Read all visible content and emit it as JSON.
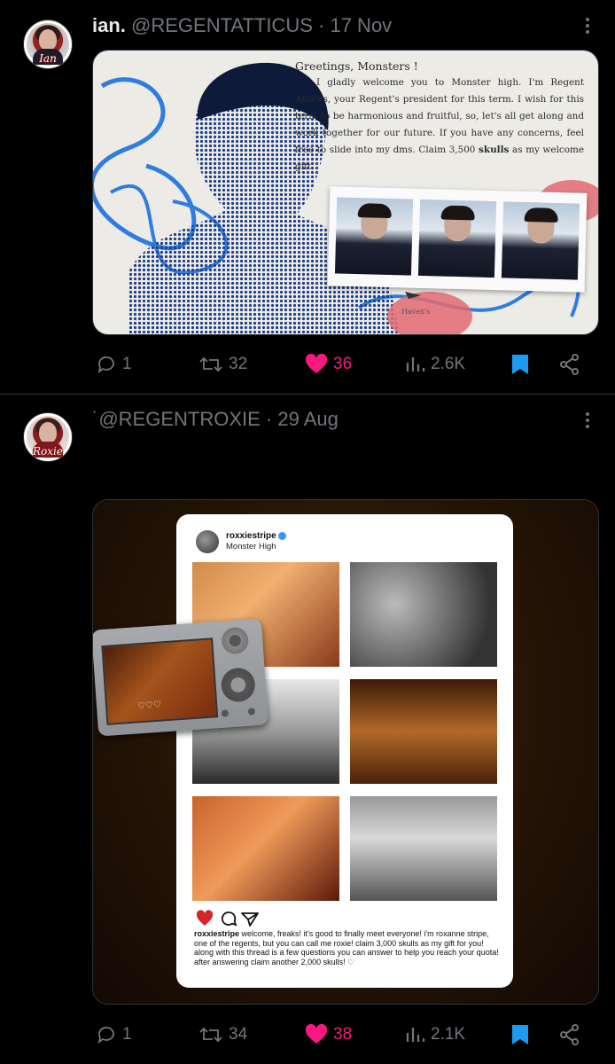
{
  "tweets": [
    {
      "avatar_sig": "Ian",
      "name": "ian.",
      "handle": "@REGENTATTICUS",
      "dot": "·",
      "date": "17 Nov",
      "media": {
        "greeting": "Greetings, Monsters !",
        "body_pre": "I gladly welcome you to Monster high. I'm Regent Atticus, your Regent's president for this term. I wish for this term to be harmonious and fruitful, so, let's all get along and work together for our future. If you have any concerns, feel free to slide into my dms. Claim 3,500 ",
        "body_bold": "skulls",
        "body_post": " as my welcome gift.",
        "signature": "Haven's"
      },
      "stats": {
        "replies": "1",
        "retweets": "32",
        "likes": "36",
        "views": "2.6K"
      }
    },
    {
      "avatar_sig": "Roxie",
      "name": "",
      "handle": "˙@REGENTROXIE",
      "dot": "·",
      "date": "29 Aug",
      "media": {
        "ig_user": "roxxiestripe",
        "ig_sub": "Monster High",
        "ig_caption_user": "roxxiestripe",
        "ig_caption": " welcome, freaks! it's good to finally meet everyone! i'm roxanne stripe, one of the regents, but you can call me roxie! claim 3,000 skulls as my gift for you! along with this thread is a few questions you can answer to help you reach your quota! after answering claim another 2,000 skulls! ♡",
        "camera_hearts": "♡♡♡"
      },
      "stats": {
        "replies": "1",
        "retweets": "34",
        "likes": "38",
        "views": "2.1K"
      }
    }
  ],
  "colors": {
    "like": "#f91880",
    "bookmark": "#1d9bf0",
    "muted": "#71767b",
    "divider": "#2f3336"
  },
  "icons": [
    "reply-icon",
    "retweet-icon",
    "heart-icon",
    "views-icon",
    "bookmark-icon",
    "share-icon",
    "more-icon"
  ]
}
